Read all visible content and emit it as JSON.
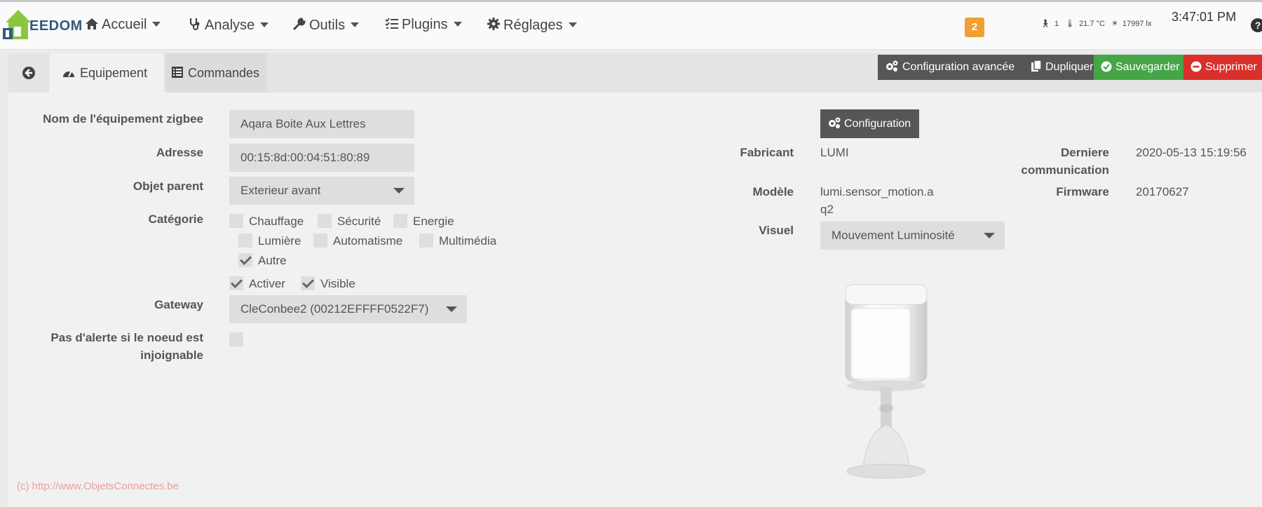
{
  "brand": {
    "logo_text": "EEDOM",
    "accent": "#8cc63f"
  },
  "nav": {
    "items": [
      {
        "icon": "home-icon",
        "label": "Accueil"
      },
      {
        "icon": "stethoscope-icon",
        "label": "Analyse"
      },
      {
        "icon": "wrench-icon",
        "label": "Outils"
      },
      {
        "icon": "list-icon",
        "label": "Plugins"
      },
      {
        "icon": "gear-icon",
        "label": "Réglages"
      }
    ],
    "badge": "2",
    "sensors": {
      "motion": "1",
      "temperature": "21.7 °C",
      "luminosity": "17997 lx"
    },
    "clock": "3:47:01 PM",
    "help": "?"
  },
  "tabs": {
    "equipement": "Equipement",
    "commandes": "Commandes"
  },
  "actions": {
    "advanced": "Configuration avancée",
    "duplicate": "Dupliquer",
    "save": "Sauvegarder",
    "delete": "Supprimer"
  },
  "form": {
    "name_label": "Nom de l'équipement zigbee",
    "name_value": "Aqara Boite Aux Lettres",
    "address_label": "Adresse",
    "address_value": "00:15:8d:00:04:51:80:89",
    "parent_label": "Objet parent",
    "parent_value": "Exterieur avant",
    "category_label": "Catégorie",
    "categories": [
      {
        "label": "Chauffage",
        "checked": false
      },
      {
        "label": "Sécurité",
        "checked": false
      },
      {
        "label": "Energie",
        "checked": false
      },
      {
        "label": "Lumière",
        "checked": false
      },
      {
        "label": "Automatisme",
        "checked": false
      },
      {
        "label": "Multimédia",
        "checked": false
      },
      {
        "label": "Autre",
        "checked": true
      }
    ],
    "activer": "Activer",
    "visible": "Visible",
    "gateway_label": "Gateway",
    "gateway_value": "CleConbee2 (00212EFFFF0522F7)",
    "alert_label_1": "Pas d'alerte si le noeud est",
    "alert_label_2": "injoignable"
  },
  "info": {
    "config_button": "Configuration",
    "fabricant_label": "Fabricant",
    "fabricant_value": "LUMI",
    "modele_label": "Modèle",
    "modele_value_1": "lumi.sensor_motion.a",
    "modele_value_2": "q2",
    "visuel_label": "Visuel",
    "visuel_value": "Mouvement Luminosité",
    "derniere_label_1": "Derniere",
    "derniere_label_2": "communication",
    "derniere_value": "2020-05-13 15:19:56",
    "firmware_label": "Firmware",
    "firmware_value": "20170627"
  },
  "footer": {
    "copyright": "(c) http://www.ObjetsConnectes.be"
  }
}
